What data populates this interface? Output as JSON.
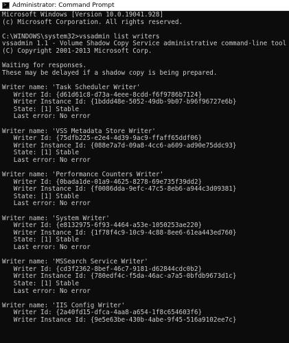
{
  "window": {
    "title": "Administrator: Command Prompt",
    "icon": "cmd-icon"
  },
  "console": {
    "lines": [
      "Microsoft Windows [Version 10.0.19041.928]",
      "(c) Microsoft Corporation. All rights reserved.",
      "",
      "C:\\WINDOWS\\system32>vssadmin list writers",
      "vssadmin 1.1 - Volume Shadow Copy Service administrative command-line tool",
      "(C) Copyright 2001-2013 Microsoft Corp.",
      "",
      "Waiting for responses.",
      "These may be delayed if a shadow copy is being prepared.",
      "",
      "Writer name: 'Task Scheduler Writer'",
      "   Writer Id: {d61d61c8-d73a-4eee-8cdd-f6f9786b7124}",
      "   Writer Instance Id: {1bddd48e-5052-49db-9b07-b96f96727e6b}",
      "   State: [1] Stable",
      "   Last error: No error",
      "",
      "Writer name: 'VSS Metadata Store Writer'",
      "   Writer Id: {75dfb225-e2e4-4d39-9ac9-ffaff65ddf06}",
      "   Writer Instance Id: {088e7a7d-09a8-4cc6-a609-ad90e75ddc93}",
      "   State: [1] Stable",
      "   Last error: No error",
      "",
      "Writer name: 'Performance Counters Writer'",
      "   Writer Id: {0bada1de-01a9-4625-8278-69e735f39dd2}",
      "   Writer Instance Id: {f0086dda-9efc-47c5-8eb6-a944c3d09381}",
      "   State: [1] Stable",
      "   Last error: No error",
      "",
      "Writer name: 'System Writer'",
      "   Writer Id: {e8132975-6f93-4464-a53e-1050253ae220}",
      "   Writer Instance Id: {1f78f4c9-10c9-4c88-8ee6-61ea443ed760}",
      "   State: [1] Stable",
      "   Last error: No error",
      "",
      "Writer name: 'MSSearch Service Writer'",
      "   Writer Id: {cd3f2362-8bef-46c7-9181-d62844cdc0b2}",
      "   Writer Instance Id: {780edf4c-f5da-46ac-a7a5-0bfdb9673d1c}",
      "   State: [1] Stable",
      "   Last error: No error",
      "",
      "Writer name: 'IIS Config Writer'",
      "   Writer Id: {2a40fd15-dfca-4aa8-a654-1f8c654603f6}",
      "   Writer Instance Id: {9e5e63be-430b-4abe-9f45-516a9102ee7c}"
    ]
  },
  "colors": {
    "background": "#0c0c0c",
    "text": "#cccccc",
    "titlebar": "#ffffff"
  }
}
